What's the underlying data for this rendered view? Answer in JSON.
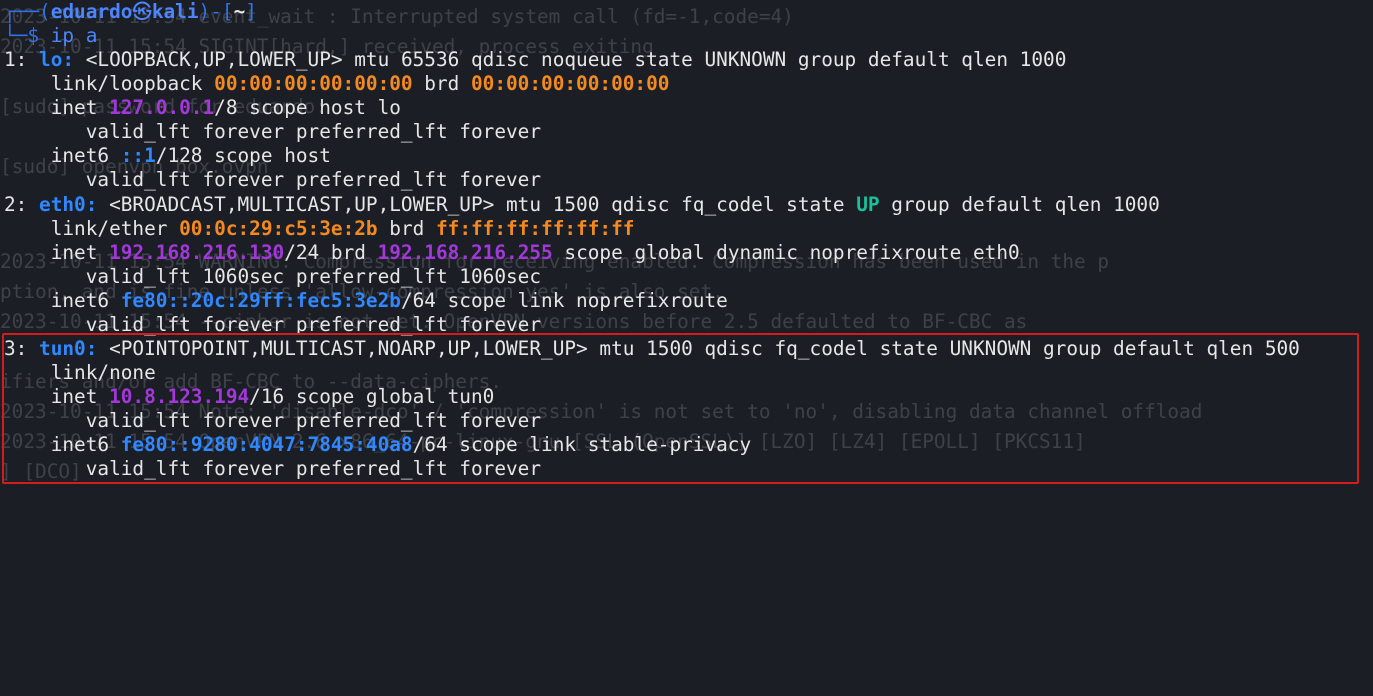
{
  "terminal": {
    "prompt": {
      "bracket_open": "┌──(",
      "user": "eduardo",
      "skull": "㉿",
      "host": "kali",
      "separator": ")-[",
      "cwd": "~",
      "bracket_close": "]",
      "cmd_prefix": "└─$ ",
      "command": "ip a"
    },
    "interfaces": [
      {
        "header_prefix": "1: ",
        "name": "lo:",
        "flags": " <LOOPBACK,UP,LOWER_UP> mtu 65536 qdisc noqueue state UNKNOWN group default qlen 1000",
        "link_prefix": "    link/loopback ",
        "mac": "00:00:00:00:00:00",
        "brd_label": " brd ",
        "brd": "00:00:00:00:00:00",
        "inet_prefix": "    inet ",
        "inet": "127.0.0.1",
        "inet_suffix": "/8 scope host lo",
        "valid1": "       valid_lft forever preferred_lft forever",
        "inet6_prefix": "    inet6 ",
        "inet6": "::1",
        "inet6_suffix": "/128 scope host",
        "valid2": "       valid_lft forever preferred_lft forever"
      },
      {
        "header_prefix": "2: ",
        "name": "eth0:",
        "flags_a": " <BROADCAST,MULTICAST,UP,LOWER_UP> mtu 1500 qdisc fq_codel state ",
        "state": "UP",
        "flags_b": " group default qlen 1000",
        "link_prefix": "    link/ether ",
        "mac": "00:0c:29:c5:3e:2b",
        "brd_label": " brd ",
        "brd": "ff:ff:ff:ff:ff:ff",
        "inet_prefix": "    inet ",
        "inet": "192.168.216.130",
        "inet_mid": "/24 brd ",
        "inet_brd": "192.168.216.255",
        "inet_suffix": " scope global dynamic noprefixroute eth0",
        "valid1": "       valid_lft 1060sec preferred_lft 1060sec",
        "inet6_prefix": "    inet6 ",
        "inet6": "fe80::20c:29ff:fec5:3e2b",
        "inet6_suffix": "/64 scope link noprefixroute",
        "valid2": "       valid_lft forever preferred_lft forever"
      },
      {
        "header_prefix": "3: ",
        "name": "tun0:",
        "flags": " <POINTOPOINT,MULTICAST,NOARP,UP,LOWER_UP> mtu 1500 qdisc fq_codel state UNKNOWN group default qlen 500",
        "link": "    link/none",
        "inet_prefix": "    inet ",
        "inet": "10.8.123.194",
        "inet_suffix": "/16 scope global tun0",
        "valid1": "       valid_lft forever preferred_lft forever",
        "inet6_prefix": "    inet6 ",
        "inet6": "fe80::9280:4047:7845:40a8",
        "inet6_suffix": "/64 scope link stable-privacy",
        "valid2": "       valid_lft forever preferred_lft forever"
      }
    ],
    "ghost_lines": [
      "2023-10-11 15:54 event_wait : Interrupted system call (fd=-1,code=4)",
      "2023-10-11 15:54 SIGINT[hard,] received, process exiting",
      "",
      "[sudo] password for eduardo:",
      "[sudo] openvpn box.ovpn",
      "2023-10-11 15:54 WARNING: Compression for receiving enabled. Compression has been used in the p",
      "ption, and is fine unless 'allow-compression yes' is also set.",
      "2023-10-11 15:54 --cipher is not set. OpenVPN versions before 2.5 defaulted to BF-CBC as",
      "ifiers and/or add BF-CBC to --data-ciphers.",
      "2023-10-11 15:54 Note: 'disable-dco' / 'compression' is not set to 'no', disabling data channel offload",
      "2023-10-11 15:54 OpenVPN 2.6 x86_64-pc-linux-gnu [SSL (OpenSSL)] [LZO] [LZ4] [EPOLL] [PKCS11]",
      "] [DCO]"
    ],
    "colors": {
      "background": "#1c1e25",
      "text": "#e6e6e6",
      "prompt": "#2f72e8",
      "interface": "#2f88ff",
      "mac": "#f48a1f",
      "ipv4": "#a238d9",
      "state_up": "#1bbf9a",
      "highlight_border": "#d11d1d"
    }
  }
}
